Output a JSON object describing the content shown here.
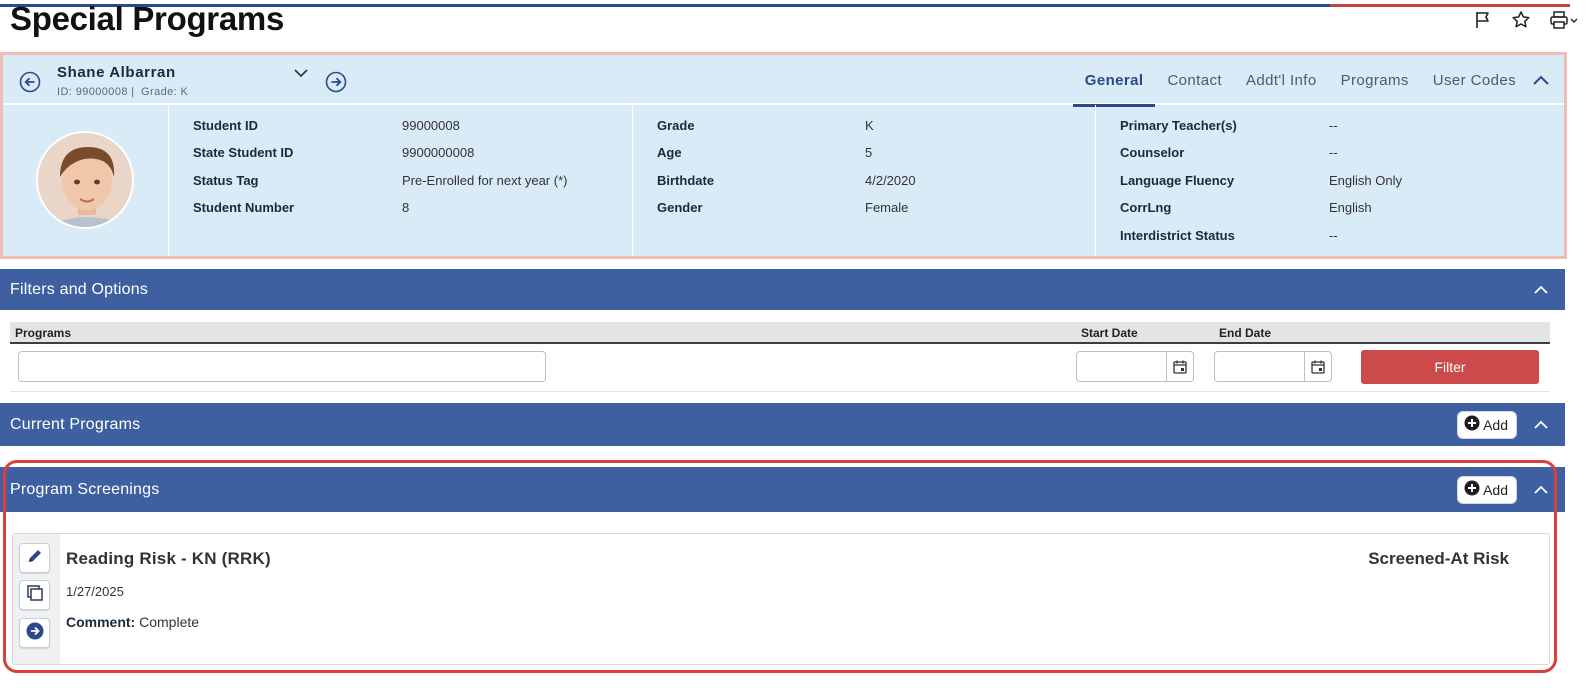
{
  "page": {
    "title": "Special Programs"
  },
  "student": {
    "name": "Shane Albarran",
    "id_line": "ID: 99000008 |",
    "grade_line": "Grade: K"
  },
  "tabs": [
    "General",
    "Contact",
    "Addt'l Info",
    "Programs",
    "User Codes"
  ],
  "info": {
    "col1": [
      {
        "label": "Student ID",
        "value": "99000008"
      },
      {
        "label": "State Student ID",
        "value": "9900000008"
      },
      {
        "label": "Status Tag",
        "value": "Pre-Enrolled for next year (*)"
      },
      {
        "label": "Student Number",
        "value": "8"
      }
    ],
    "col2": [
      {
        "label": "Grade",
        "value": "K"
      },
      {
        "label": "Age",
        "value": "5"
      },
      {
        "label": "Birthdate",
        "value": "4/2/2020"
      },
      {
        "label": "Gender",
        "value": "Female"
      }
    ],
    "col3": [
      {
        "label": "Primary Teacher(s)",
        "value": "--"
      },
      {
        "label": "Counselor",
        "value": "--"
      },
      {
        "label": "Language Fluency",
        "value": "English Only"
      },
      {
        "label": "CorrLng",
        "value": "English"
      },
      {
        "label": "Interdistrict Status",
        "value": "--"
      }
    ]
  },
  "filters": {
    "title": "Filters and Options",
    "programs_label": "Programs",
    "programs_value": "",
    "start_label": "Start Date",
    "start_value": "",
    "end_label": "End Date",
    "end_value": "",
    "button": "Filter"
  },
  "current_programs": {
    "title": "Current Programs",
    "add_label": "Add"
  },
  "screenings": {
    "title": "Program Screenings",
    "add_label": "Add",
    "items": [
      {
        "title": "Reading Risk - KN (RRK)",
        "date": "1/27/2025",
        "comment_label": "Comment:",
        "comment": "Complete",
        "status": "Screened-At Risk"
      }
    ]
  },
  "colors": {
    "section_bar": "#3f60a0",
    "banner_bg": "#d9ebf7",
    "filter_button": "#cc4a4a",
    "highlight": "#d9403c"
  },
  "icons": [
    "flag-icon",
    "star-icon",
    "print-icon",
    "arrow-left-circle-icon",
    "arrow-right-circle-icon",
    "chevron-down-icon",
    "chevron-up-icon",
    "calendar-icon",
    "plus-circle-icon",
    "pencil-icon",
    "copy-icon"
  ]
}
